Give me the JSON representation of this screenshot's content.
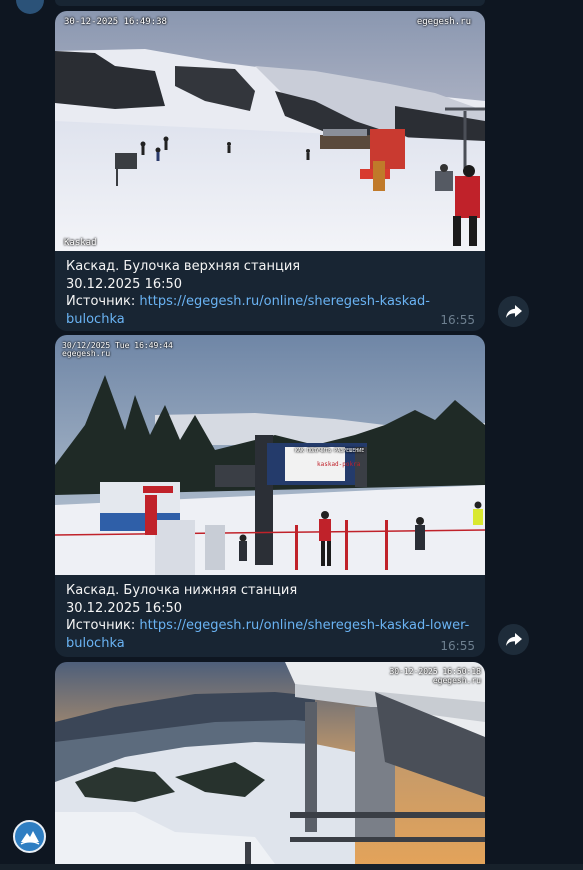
{
  "messages": [
    {
      "cam_timestamp": "30-12-2025 16:49:38",
      "cam_brand": "egegesh.ru",
      "cam_label": "Kaskad",
      "title": "Каскад. Булочка верхняя станция",
      "datetime": "30.12.2025 16:50",
      "source_label": "Источник: ",
      "source_url_line1": "https://egegesh.ru/online/sheregesh-kaskad-bulochka",
      "source_url_line2": "",
      "time": "16:55"
    },
    {
      "cam_timestamp": "30/12/2025 Tue 16:49:44",
      "cam_brand": "egegesh.ru",
      "billboard_text": "КАК ПОЛУЧИТЬ РАЗРЕШЕНИЕ",
      "billboard_site": "kaskad-pokra",
      "title": "Каскад. Булочка нижняя станция",
      "datetime": "30.12.2025 16:50",
      "source_label": "Источник: ",
      "source_url_line1": "https://egegesh.ru/online/sheregesh-kaskad-lower-",
      "source_url_line2": "bulochka",
      "time": "16:55"
    },
    {
      "cam_timestamp": "30-12-2025 16:50:18",
      "cam_brand": "egegesh.ru"
    }
  ],
  "icons": {
    "share": "share-arrow-icon",
    "avatar": "channel-avatar-icon"
  },
  "colors": {
    "background": "#0e1621",
    "bubble": "#182533",
    "link": "#6ab3f3",
    "meta": "#6d7f8f"
  }
}
